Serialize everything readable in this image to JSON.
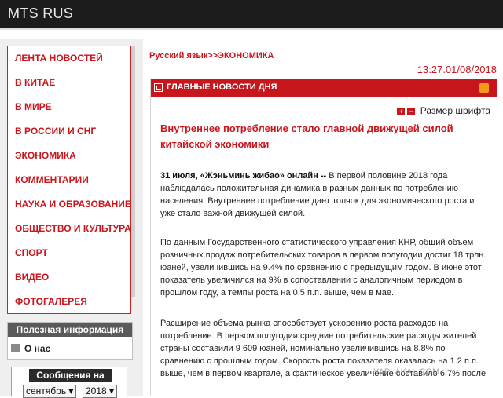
{
  "app": {
    "title": "MTS RUS"
  },
  "nav": {
    "items": [
      "ЛЕНТА НОВОСТЕЙ",
      "В КИТАЕ",
      "В МИРЕ",
      "В РОССИИ И СНГ",
      "ЭКОНОМИКА",
      "КОММЕНТАРИИ",
      "НАУКА И ОБРАЗОВАНИЕ",
      "ОБЩЕСТВО И КУЛЬТУРА",
      "СПОРТ",
      "ВИДЕО",
      "ФОТОГАЛЕРЕЯ"
    ]
  },
  "info": {
    "header": "Полезная информация",
    "about": "О нас"
  },
  "messages": {
    "header": "Сообщения на",
    "month": "сентябрь ▾",
    "year": "2018 ▾"
  },
  "breadcrumb": "Русский язык>>ЭКОНОМИКА",
  "datetime": "13:27.01/08/2018",
  "panel": {
    "title": "ГЛАВНЫЕ НОВОСТИ ДНЯ",
    "font_size_label": "Размер шрифта"
  },
  "article": {
    "headline": "Внутреннее потребление стало главной движущей силой китайской экономики",
    "lead_bold": "31 июля, «Жэньминь жибао» онлайн --",
    "lead": " В первой половине 2018 года наблюдалась положительная динамика в разных данных по потреблению населения. Внутреннее потребление дает толчок для экономического роста и уже стало важной движущей силой.",
    "p2": "По данным Государственного статистического управления КНР, общий объем розничных продаж потребительских товаров в первом полугодии достиг 18 трлн. юаней, увеличившись на 9.4% по сравнению с предыдущим годом. В июне этот показатель увеличился на 9% в сопоставлении с аналогичным периодом в прошлом году, а темпы роста на 0.5 п.п. выше, чем в мае.",
    "p3": "Расширение объема рынка способствует ускорению роста расходов на потребление. В первом полугодии средние потребительские расходы жителей страны составили 9 609 юаней, номинально увеличившись на 8.8% по сравнению с прошлым годом. Скорость роста показателя оказалась на 1.2 п.п. выше, чем в первом квартале, а фактическое увеличение составило 6.7% после"
  },
  "watermark": "YAPLAKAL.COM",
  "colors": {
    "accent": "#c8161d",
    "topbar": "#1c1c1c"
  }
}
